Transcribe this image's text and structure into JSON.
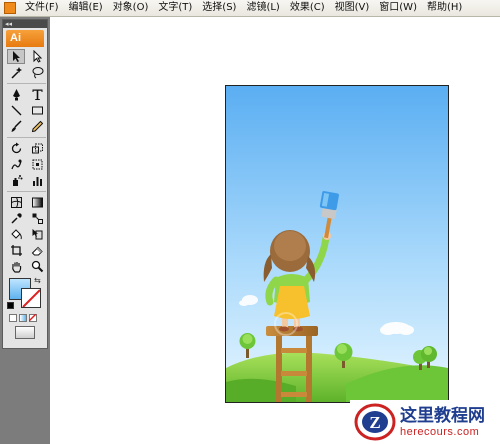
{
  "menubar": {
    "items": [
      "文件(F)",
      "编辑(E)",
      "对象(O)",
      "文字(T)",
      "选择(S)",
      "滤镜(L)",
      "效果(C)",
      "视图(V)",
      "窗口(W)",
      "帮助(H)"
    ]
  },
  "tools_panel": {
    "collapse_glyph": "◂◂",
    "logo_text": "Ai",
    "fill_color": "#7cc5f5",
    "stroke": "none (red slash)",
    "tools": [
      "selection-tool",
      "direct-selection-tool",
      "magic-wand-tool",
      "lasso-tool",
      "pen-tool",
      "type-tool",
      "line-segment-tool",
      "rectangle-tool",
      "paintbrush-tool",
      "pencil-tool",
      "rotate-tool",
      "scale-tool",
      "warp-tool",
      "free-transform-tool",
      "symbol-sprayer-tool",
      "column-graph-tool",
      "mesh-tool",
      "gradient-tool",
      "eyedropper-tool",
      "blend-tool",
      "live-paint-bucket-tool",
      "live-paint-selection-tool",
      "crop-area-tool",
      "eraser-tool",
      "hand-tool",
      "zoom-tool"
    ]
  },
  "watermark": {
    "title": "这里教程网",
    "url": "herecours.com",
    "logo_letter": "Z"
  },
  "colors": {
    "sky_top": "#5aaef2",
    "sky_bottom": "#e6f6ff",
    "grass": "#7ccd3d",
    "accent_orange": "#f08a1a"
  }
}
